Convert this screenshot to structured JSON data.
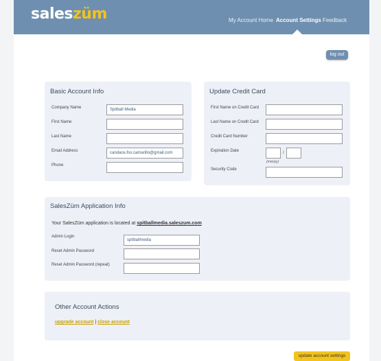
{
  "header": {
    "logo_part1": "sales",
    "logo_part2": "züm",
    "nav": [
      "My Account Home",
      "Account Settings",
      "Feedback"
    ]
  },
  "logout_label": "log out",
  "basic": {
    "title": "Basic Account Info",
    "company_label": "Company Name",
    "company_value": "Spitball Media",
    "first_label": "First Name",
    "first_value": "",
    "last_label": "Last Name",
    "last_value": "",
    "email_label": "Email Address",
    "email_value": "candace.fox.camarillo@gmail.com",
    "phone_label": "Phone",
    "phone_value": ""
  },
  "card": {
    "title": "Update Credit Card",
    "first_label": "First Name on Credit Card",
    "last_label": "Last Name on Credit Card",
    "number_label": "Credit Card Number",
    "exp_label": "Expiration Date",
    "exp_sep": "/",
    "exp_hint": "(mm/yy)",
    "security_label": "Security Code"
  },
  "app": {
    "title": "SalesZüm Application Info",
    "located_text": "Your SalesZüm application is located at",
    "url": "spitballmedia.saleszum.com",
    "admin_label": "Admin Login",
    "admin_value": "spitballmedia",
    "reset_label": "Reset Admin Password",
    "reset_repeat_label": "Reset Admin Password (repeat)"
  },
  "other": {
    "title": "Other Account Actions",
    "upgrade": "upgrade account",
    "separator": "|",
    "close": "close account"
  },
  "update_button": "update account settings"
}
